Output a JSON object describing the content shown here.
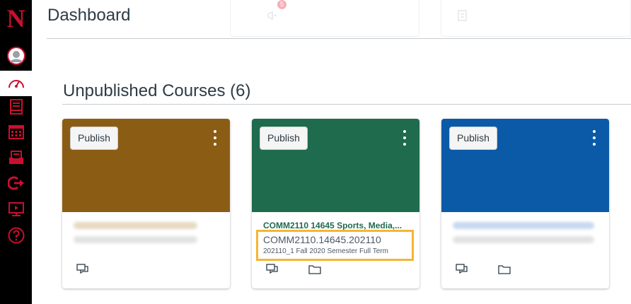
{
  "nav": {
    "logo": "N",
    "items": [
      {
        "name": "nav-account",
        "icon": "user-avatar-icon"
      },
      {
        "name": "nav-dashboard",
        "icon": "speedometer-icon",
        "active": true
      },
      {
        "name": "nav-courses",
        "icon": "book-icon"
      },
      {
        "name": "nav-calendar",
        "icon": "calendar-icon"
      },
      {
        "name": "nav-inbox",
        "icon": "inbox-icon"
      },
      {
        "name": "nav-history",
        "icon": "arrow-out-icon"
      },
      {
        "name": "nav-studio",
        "icon": "video-screen-icon"
      },
      {
        "name": "nav-help",
        "icon": "help-circle-icon"
      }
    ],
    "accent": "#c8102e"
  },
  "header": {
    "title": "Dashboard",
    "notification_badge": "5"
  },
  "section": {
    "title": "Unpublished Courses (6)"
  },
  "cards": [
    {
      "color": "#8b5d14",
      "publish_label": "Publish"
    },
    {
      "color": "#1f6b4d",
      "publish_label": "Publish",
      "course_name": "COMM2110 14645 Sports, Media,...",
      "course_code": "COMM2110.14645.202110",
      "course_term": "202110_1 Fall 2020 Semester Full Term"
    },
    {
      "color": "#0b5aa8",
      "publish_label": "Publish"
    }
  ],
  "highlight_color": "#f5b533"
}
